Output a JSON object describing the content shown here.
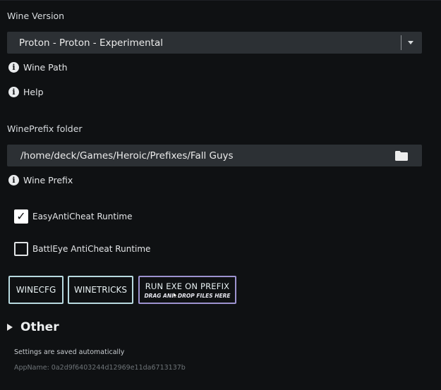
{
  "wine_version": {
    "label": "Wine Version",
    "selected": "Proton - Proton - Experimental"
  },
  "info_links": {
    "wine_path": "Wine Path",
    "help": "Help",
    "wine_prefix": "Wine Prefix"
  },
  "wineprefix_folder": {
    "label": "WinePrefix folder",
    "value": "/home/deck/Games/Heroic/Prefixes/Fall Guys"
  },
  "checkboxes": {
    "easyanticheat": {
      "label": "EasyAntiCheat Runtime",
      "checked": true
    },
    "battleye": {
      "label": "BattlEye AntiCheat Runtime",
      "checked": false
    }
  },
  "buttons": {
    "winecfg": "WINECFG",
    "winetricks": "WINETRICKS",
    "run_exe_title": "RUN EXE ON PREFIX",
    "run_exe_subtitle": "DRAG AND DROP FILES HERE"
  },
  "other": {
    "label": "Other"
  },
  "footer": {
    "saved_note": "Settings are saved automatically",
    "appname": "AppName:  0a2d9f6403244d12969e11da6713137b"
  },
  "colors": {
    "background": "#0f1113",
    "field": "#2c3034",
    "button_border": "#b8dae0",
    "exe_button_border": "#9d93d0"
  }
}
